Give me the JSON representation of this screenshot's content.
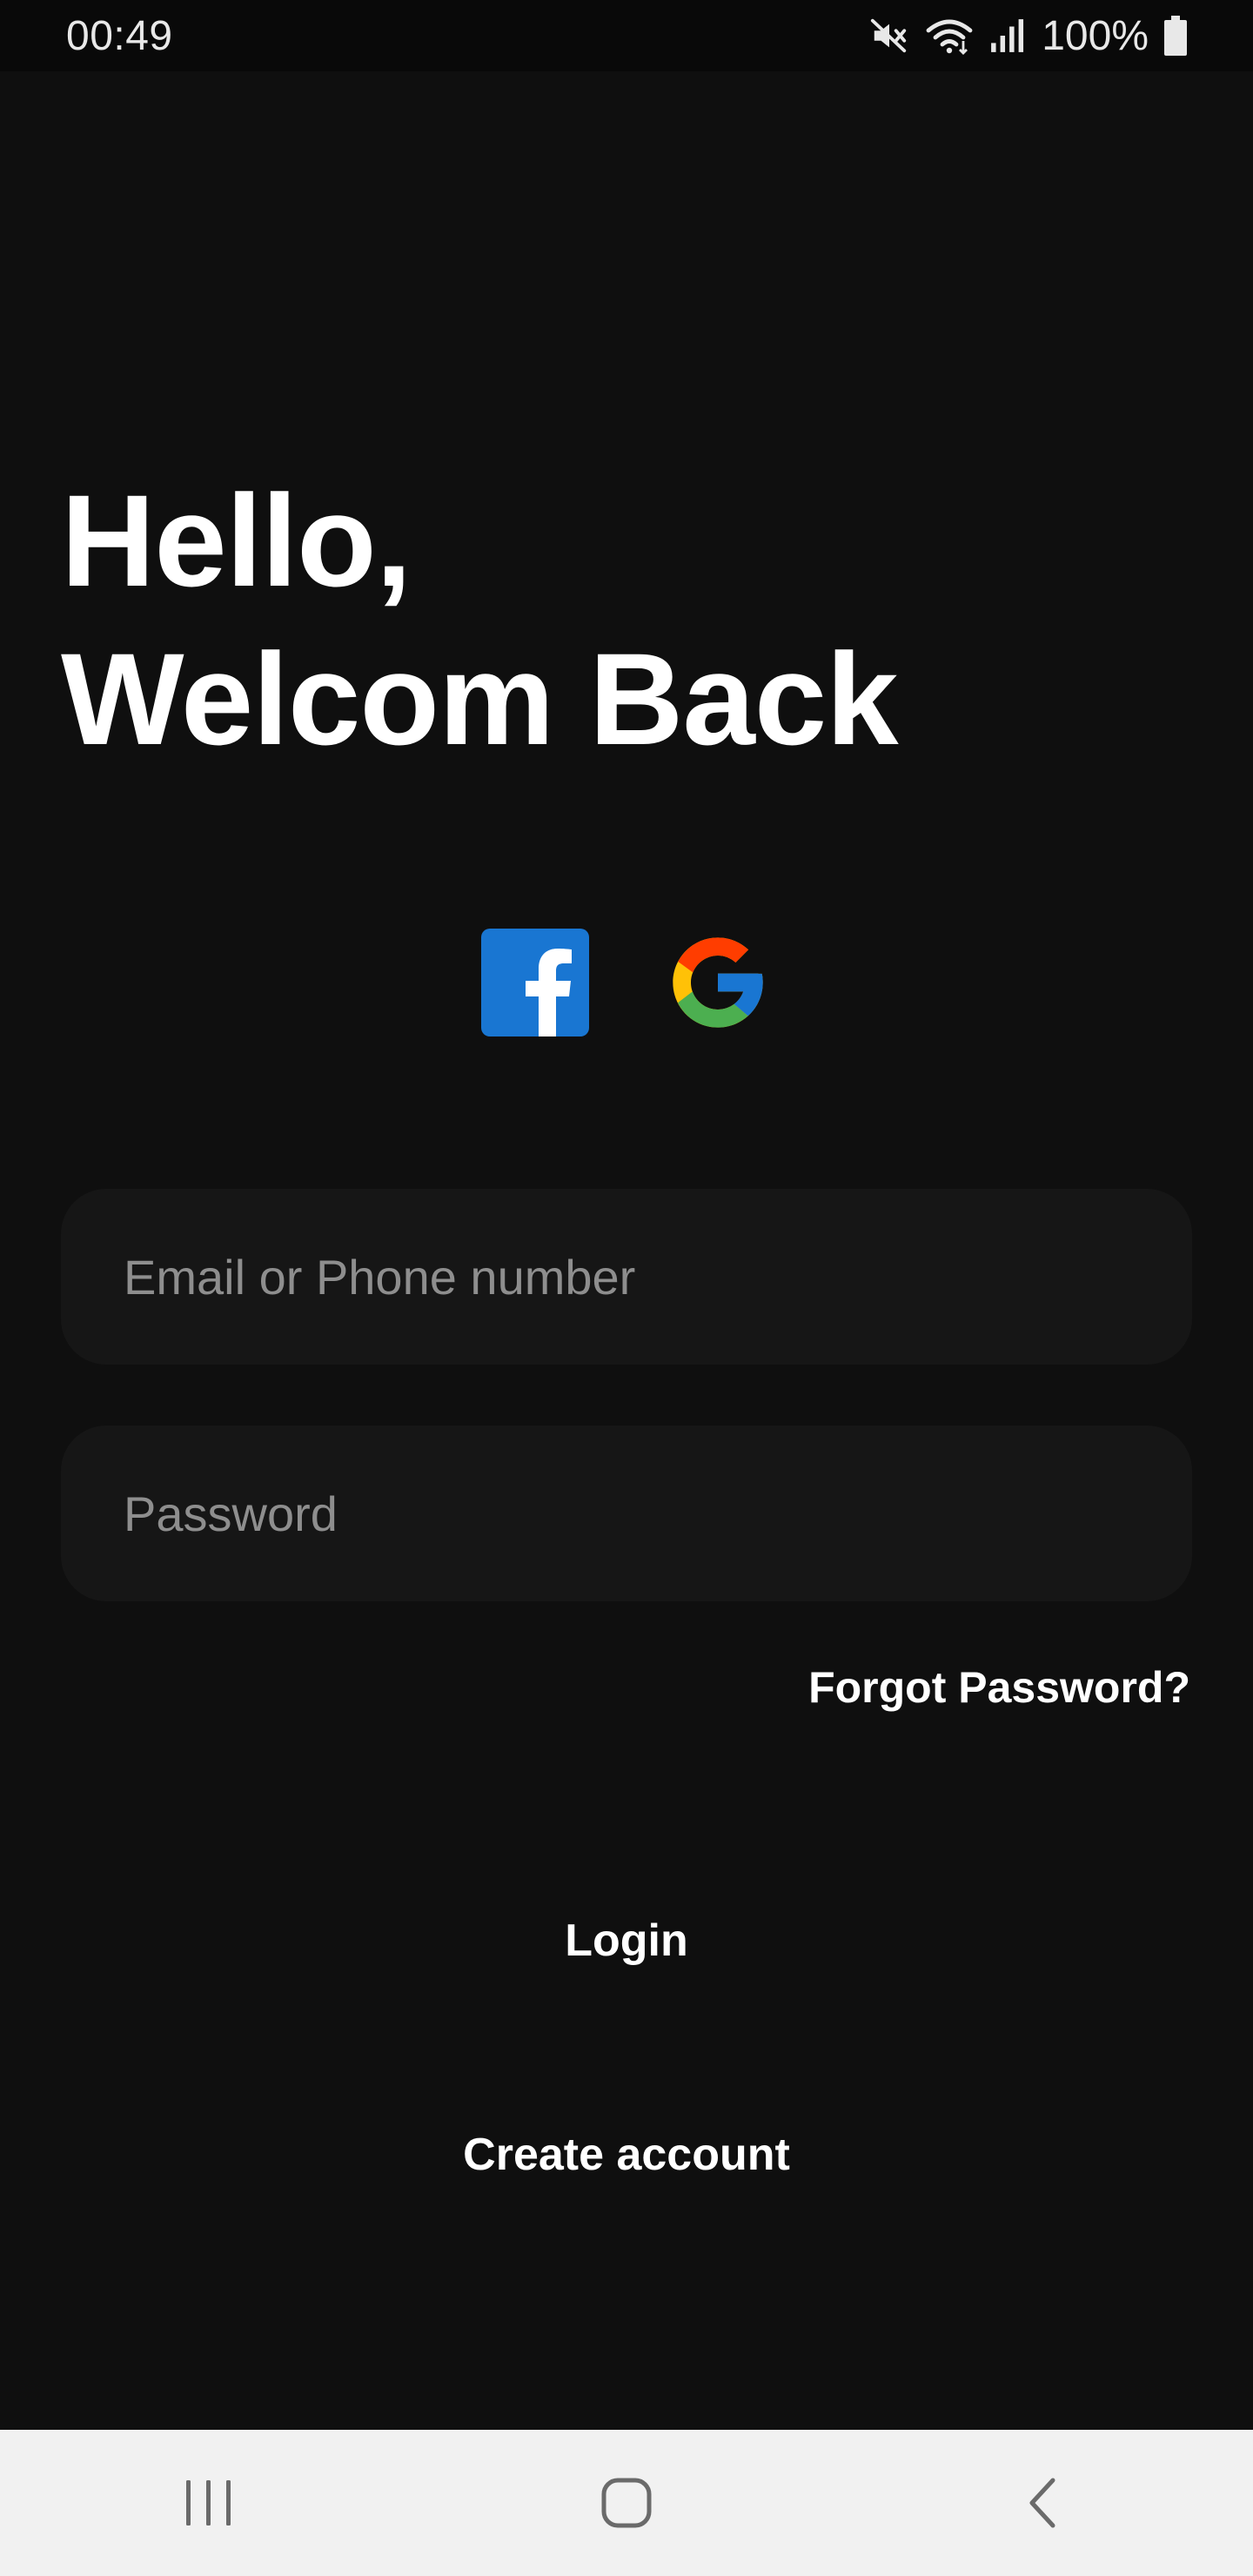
{
  "status_bar": {
    "time": "00:49",
    "battery_text": "100%",
    "icons": [
      "mute-icon",
      "wifi-icon",
      "signal-icon",
      "battery-icon"
    ]
  },
  "greeting": {
    "line1": "Hello,",
    "line2": "Welcom Back"
  },
  "social": {
    "facebook_icon": "facebook-icon",
    "google_icon": "google-icon",
    "facebook_color": "#1976D2"
  },
  "form": {
    "email_placeholder": "Email or Phone number",
    "email_value": "",
    "password_placeholder": "Password",
    "password_value": "",
    "forgot_label": "Forgot Password?"
  },
  "actions": {
    "login_label": "Login",
    "create_label": "Create account"
  },
  "nav": {
    "icons": [
      "recents-icon",
      "home-icon",
      "back-icon"
    ]
  },
  "colors": {
    "background": "#0f0f0f",
    "field_background": "#161616",
    "placeholder": "#8e8e8e",
    "nav_background": "#f1f1f1"
  }
}
